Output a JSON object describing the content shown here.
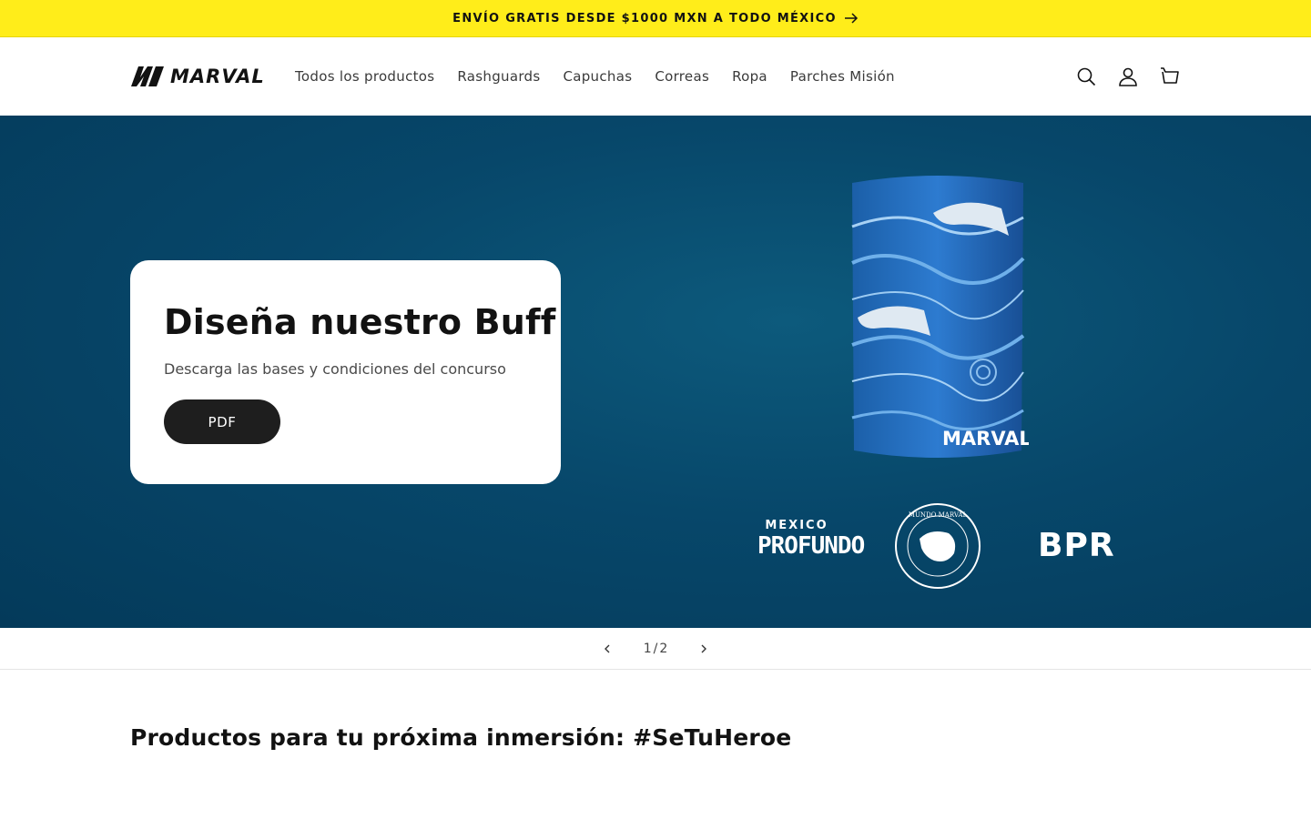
{
  "announcement": {
    "text": "ENVÍO GRATIS DESDE $1000 MXN A TODO MÉXICO"
  },
  "header": {
    "logo_text": "MARVAL",
    "nav": [
      "Todos los productos",
      "Rashguards",
      "Capuchas",
      "Correas",
      "Ropa",
      "Parches Misión"
    ],
    "icons": [
      "search-icon",
      "account-icon",
      "cart-icon"
    ]
  },
  "hero": {
    "title": "Diseña nuestro Buff",
    "subtitle": "Descarga las bases y condiciones del concurso",
    "button_label": "PDF",
    "product_brand": "MARVAL",
    "logos": {
      "profundo_top": "MEXICO",
      "profundo_bottom": "PROFUNDO",
      "seal": "MUNDO MARVAL",
      "bpr": "BPR"
    },
    "background_color": "#07476a"
  },
  "slider": {
    "current": "1",
    "separator": "/",
    "total": "2"
  },
  "featured": {
    "title": "Productos para tu próxima inmersión: #SeTuHeroe"
  },
  "colors": {
    "announcement_bg": "#ffed1a",
    "button_bg": "#1e1e1e"
  }
}
